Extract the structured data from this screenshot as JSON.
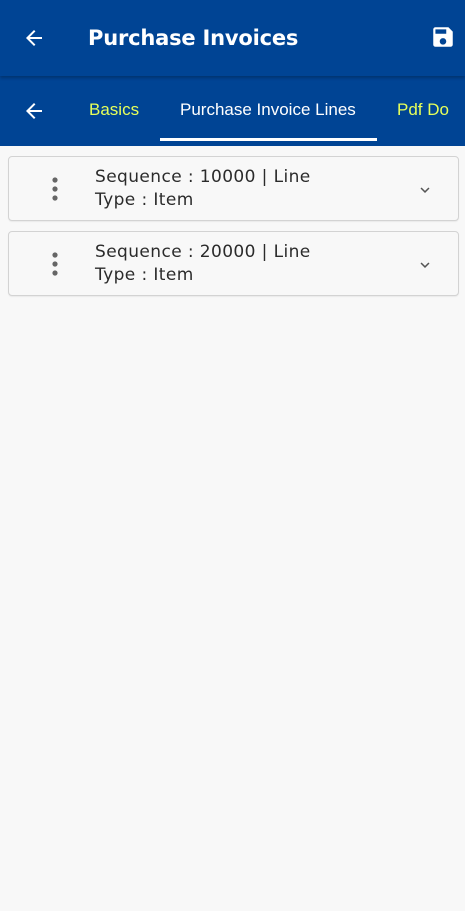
{
  "app_bar": {
    "title": "Purchase Invoices",
    "back_icon": "arrow-left-icon",
    "save_icon": "floppy-disk-icon"
  },
  "tabs": {
    "back_icon": "arrow-left-icon",
    "items": [
      {
        "label": "Basics",
        "active": false,
        "color": "#e6ff5a"
      },
      {
        "label": "Purchase Invoice Lines",
        "active": true,
        "color": "#ffffff"
      },
      {
        "label": "Pdf Do",
        "active": false,
        "color": "#e6ff5a"
      }
    ]
  },
  "lines": [
    {
      "row1": "Sequence  : 10000 | Line",
      "row2": "Type  : Item"
    },
    {
      "row1": "Sequence  : 20000 | Line",
      "row2": "Type  : Item"
    }
  ],
  "colors": {
    "primary": "#004494",
    "tab_inactive": "#e6ff5a",
    "tab_active": "#ffffff",
    "background": "#f8f8f8"
  }
}
